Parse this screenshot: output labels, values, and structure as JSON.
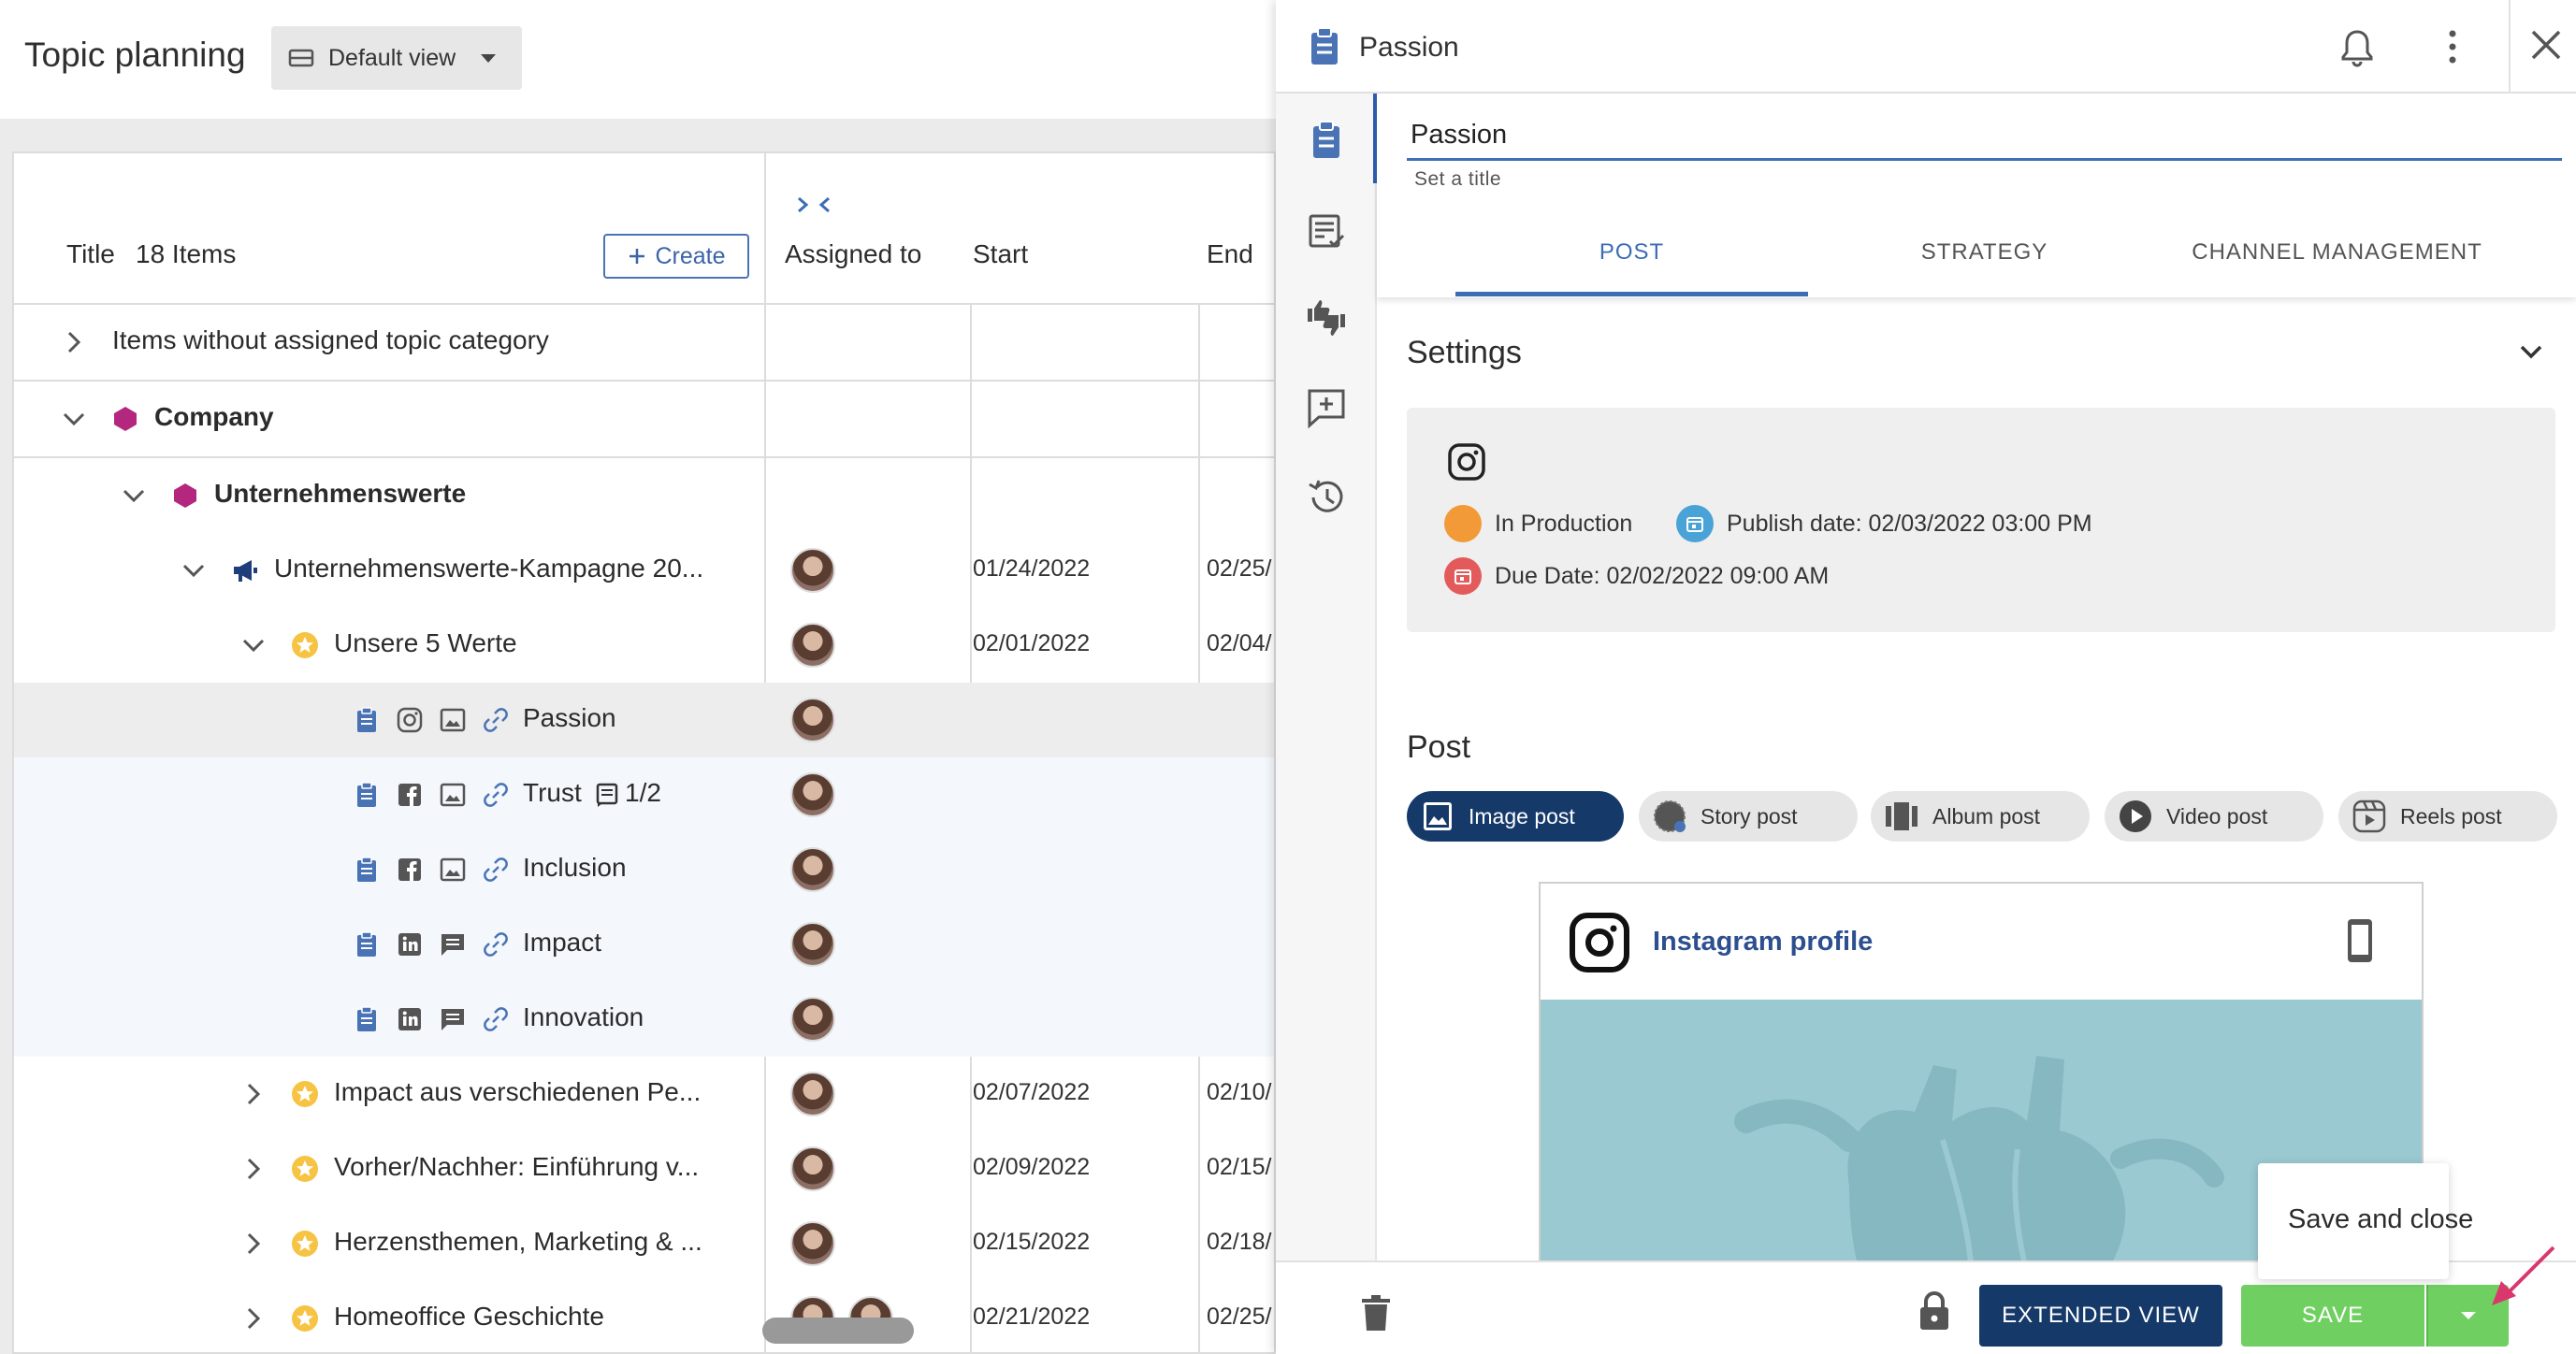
{
  "topbar": {
    "title": "Topic planning",
    "view_label": "Default view"
  },
  "grid": {
    "title_header": "Title",
    "items_count": "18 Items",
    "create_label": "Create",
    "columns": [
      "Assigned to",
      "Start",
      "End"
    ],
    "rows": [
      {
        "label": "Items without assigned topic category",
        "start": "",
        "end": ""
      },
      {
        "label": "Company",
        "start": "",
        "end": ""
      },
      {
        "label": "Unternehmenswerte",
        "start": "",
        "end": ""
      },
      {
        "label": "Unternehmenswerte-Kampagne 20...",
        "start": "01/24/2022",
        "end": "02/25/"
      },
      {
        "label": "Unsere 5 Werte",
        "start": "02/01/2022",
        "end": "02/04/"
      },
      {
        "label": "Passion",
        "start": "",
        "end": ""
      },
      {
        "label": "Trust",
        "extra": "1/2",
        "start": "",
        "end": ""
      },
      {
        "label": "Inclusion",
        "start": "",
        "end": ""
      },
      {
        "label": "Impact",
        "start": "",
        "end": ""
      },
      {
        "label": "Innovation",
        "start": "",
        "end": ""
      },
      {
        "label": "Impact aus verschiedenen Pe...",
        "start": "02/07/2022",
        "end": "02/10/"
      },
      {
        "label": "Vorher/Nachher: Einführung v...",
        "start": "02/09/2022",
        "end": "02/15/"
      },
      {
        "label": "Herzensthemen, Marketing & ...",
        "start": "02/15/2022",
        "end": "02/18/"
      },
      {
        "label": "Homeoffice Geschichte",
        "start": "02/21/2022",
        "end": "02/25/"
      }
    ]
  },
  "panel": {
    "title": "Passion",
    "title_input_value": "Passion",
    "title_hint": "Set a title",
    "tabs": [
      "POST",
      "STRATEGY",
      "CHANNEL MANAGEMENT"
    ],
    "settings": {
      "heading": "Settings",
      "status": "In Production",
      "publish_date": "Publish date: 02/03/2022 03:00 PM",
      "due_date": "Due Date: 02/02/2022 09:00 AM"
    },
    "post": {
      "heading": "Post",
      "types": [
        "Image post",
        "Story post",
        "Album post",
        "Video post",
        "Reels post"
      ],
      "preview_profile": "Instagram profile"
    },
    "footer": {
      "extended_view": "EXTENDED VIEW",
      "save": "SAVE",
      "menu_item": "Save and close"
    }
  },
  "colors": {
    "navy": "#153a6a",
    "accent_blue": "#3c6cb4",
    "save_green": "#6fd061",
    "company_magenta": "#b4277e",
    "status_orange": "#f29a38",
    "due_red": "#e35a5a",
    "publish_blue": "#4aa3d6",
    "star_yellow": "#f6c343",
    "preview_image": "#9bc9d1",
    "arrow_pink": "#d9376e"
  },
  "icons": [
    "view-list-icon",
    "caret-down-icon",
    "collapse-columns-icon",
    "plus-icon",
    "chevron-right-icon",
    "chevron-down-icon",
    "hexagon-icon",
    "megaphone-icon",
    "star-icon",
    "clipboard-icon",
    "instagram-icon",
    "facebook-icon",
    "linkedin-icon",
    "image-icon",
    "comment-icon",
    "link-icon",
    "notes-icon",
    "bell-icon",
    "kebab-icon",
    "close-icon",
    "checklist-icon",
    "thumbs-icon",
    "feedback-icon",
    "history-icon",
    "trash-icon",
    "lock-icon",
    "smartphone-icon",
    "video-icon",
    "album-icon",
    "reels-icon"
  ]
}
